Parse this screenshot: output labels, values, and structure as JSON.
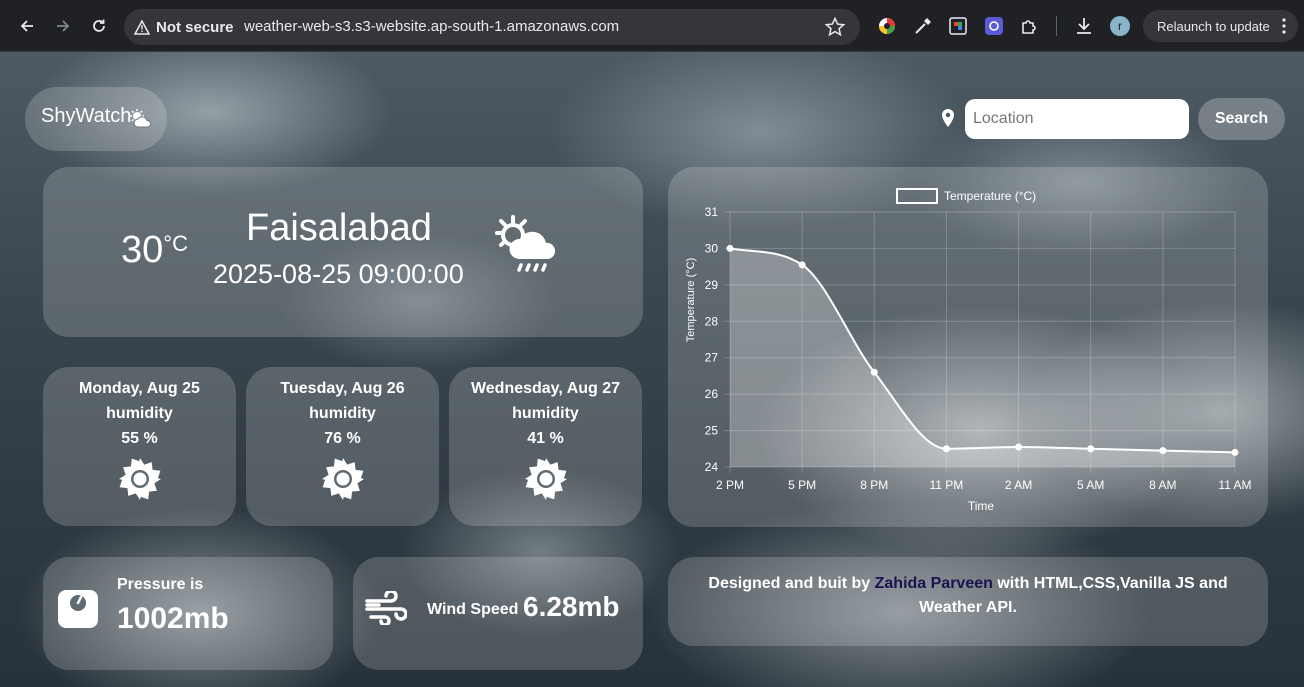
{
  "browser": {
    "security_label": "Not secure",
    "url": "weather-web-s3.s3-website.ap-south-1.amazonaws.com",
    "profile_initial": "r",
    "relaunch_label": "Relaunch to update"
  },
  "header": {
    "brand": "ShyWatch",
    "search": {
      "placeholder": "Location",
      "value": "",
      "button_label": "Search"
    }
  },
  "current": {
    "temperature": "30",
    "unit": "°C",
    "city": "Faisalabad",
    "datetime": "2025-08-25 09:00:00",
    "icon": "sun-cloud-rain-icon"
  },
  "forecast": [
    {
      "day": "Monday, Aug 25",
      "label": "humidity",
      "humidity": "55 %",
      "icon": "sun-icon"
    },
    {
      "day": "Tuesday, Aug 26",
      "label": "humidity",
      "humidity": "76 %",
      "icon": "sun-icon"
    },
    {
      "day": "Wednesday, Aug 27",
      "label": "humidity",
      "humidity": "41 %",
      "icon": "sun-icon"
    }
  ],
  "pressure": {
    "label": "Pressure is",
    "value": "1002mb"
  },
  "wind": {
    "label": "Wind Speed",
    "value": "6.28mb"
  },
  "credits": {
    "prefix": "Designed and buit by ",
    "author": "Zahida Parveen",
    "suffix": " with HTML,CSS,Vanilla JS and Weather API."
  },
  "chart_data": {
    "type": "line",
    "categories": [
      "2 PM",
      "5 PM",
      "8 PM",
      "11 PM",
      "2 AM",
      "5 AM",
      "8 AM",
      "11 AM"
    ],
    "series": [
      {
        "name": "Temperature (°C)",
        "values": [
          30.0,
          29.55,
          26.6,
          24.5,
          24.55,
          24.5,
          24.45,
          24.4
        ]
      }
    ],
    "title": "",
    "xlabel": "Time",
    "ylabel": "Temperature (°C)",
    "ylim": [
      24,
      31
    ],
    "yticks": [
      24,
      25,
      26,
      27,
      28,
      29,
      30,
      31
    ],
    "grid": true,
    "legend": "top"
  }
}
